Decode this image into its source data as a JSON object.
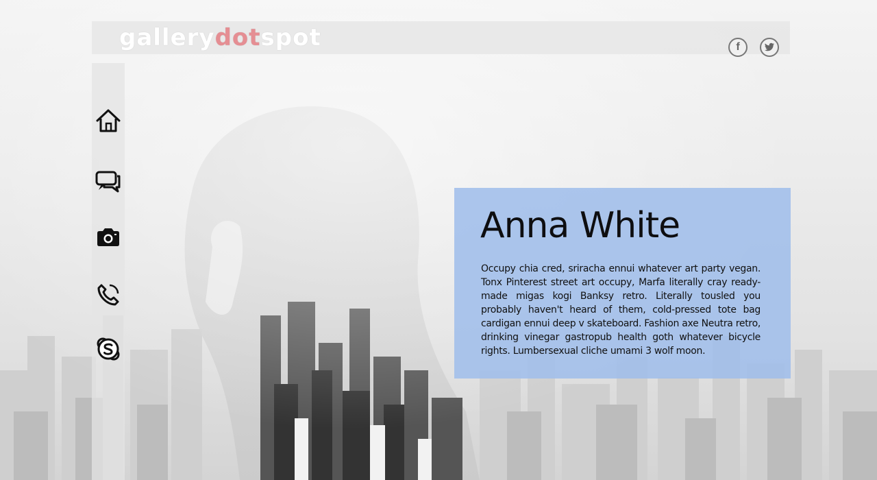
{
  "header": {
    "logo_part1": "gallery",
    "logo_part2": "dot",
    "logo_part3": "spot"
  },
  "social": {
    "facebook_glyph": "f",
    "twitter_glyph": "t"
  },
  "sidebar": {
    "items": [
      {
        "icon": "home-icon"
      },
      {
        "icon": "chat-icon"
      },
      {
        "icon": "camera-icon"
      },
      {
        "icon": "phone-icon"
      },
      {
        "icon": "skype-icon"
      }
    ]
  },
  "profile": {
    "name": "Anna White",
    "bio": "Occupy chia cred, sriracha ennui whatever art party vegan. Tonx Pinterest street art occupy, Marfa literally cray ready-made migas kogi Banksy retro. Literally tousled you probably haven't heard of them, cold-pressed tote bag cardigan ennui deep v skateboard. Fashion axe Neutra retro, drinking vinegar gastropub health goth whatever bicycle rights. Lumbersexual cliche umami 3 wolf moon."
  },
  "colors": {
    "accent_logo": "#e58e93",
    "card_bg": "#a0beeb"
  }
}
